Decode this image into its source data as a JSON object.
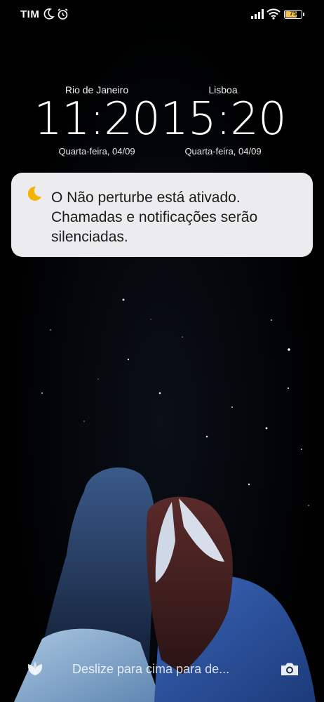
{
  "status_bar": {
    "carrier": "TIM",
    "battery_level": "75",
    "icons": [
      "moon-icon",
      "alarm-icon",
      "signal-icon",
      "wifi-icon",
      "battery-icon"
    ]
  },
  "clocks": [
    {
      "city": "Rio de Janeiro",
      "time": "11:20",
      "date": "Quarta-feira, 04/09"
    },
    {
      "city": "Lisboa",
      "time": "15:20",
      "date": "Quarta-feira, 04/09"
    }
  ],
  "dnd_notification": {
    "icon": "moon-icon",
    "text": "O Não perturbe está ativado. Chamadas e notificações serão silenciadas.",
    "accent_color": "#f5b301"
  },
  "bottom_bar": {
    "swipe_hint": "Deslize para cima para de...",
    "left_icon": "leaf-icon",
    "right_icon": "camera-icon"
  },
  "colors": {
    "background": "#000000",
    "card": "#ececee",
    "battery_fill": "#f5c451"
  }
}
